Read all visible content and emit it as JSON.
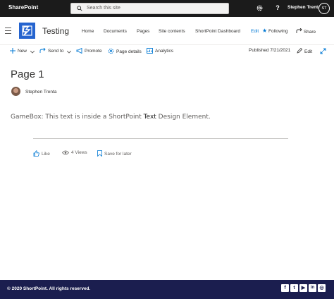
{
  "suite_bar": {
    "app_name": "SharePoint",
    "search_placeholder": "Search this site",
    "user_name": "Stephen Trenta",
    "user_initials": "ST",
    "help_glyph": "?",
    "icons": [
      "search-icon",
      "gear-icon",
      "help-icon"
    ]
  },
  "site_header": {
    "site_title": "Testing",
    "nav": [
      "Home",
      "Documents",
      "Pages",
      "Site contents",
      "ShortPoint Dashboard",
      "Edit"
    ],
    "following_label": "Following",
    "share_label": "Share",
    "logo_color": "#2564cf"
  },
  "command_bar": {
    "new_label": "New",
    "send_to_label": "Send to",
    "promote_label": "Promote",
    "page_details_label": "Page details",
    "analytics_label": "Analytics",
    "published_label": "Published 7/21/2021",
    "edit_label": "Edit"
  },
  "page": {
    "title": "Page 1",
    "author": "Stephen Trenta",
    "text_before": "GameBox: This text is inside a ShortPoint ",
    "text_emphasis": "Text",
    "text_after": " Design Element."
  },
  "social_bar": {
    "like_label": "Like",
    "views_label": "4 Views",
    "save_label": "Save for later"
  },
  "footer": {
    "copyright": "© 2020 ShortPoint. All rights reserved.",
    "background": "#1b1e4f",
    "social_icons": [
      {
        "name": "facebook-icon",
        "glyph": "f"
      },
      {
        "name": "twitter-icon",
        "glyph": "t"
      },
      {
        "name": "youtube-icon",
        "glyph": "▶"
      },
      {
        "name": "linkedin-icon",
        "glyph": "in"
      },
      {
        "name": "dribbble-icon",
        "glyph": "◎"
      }
    ]
  }
}
